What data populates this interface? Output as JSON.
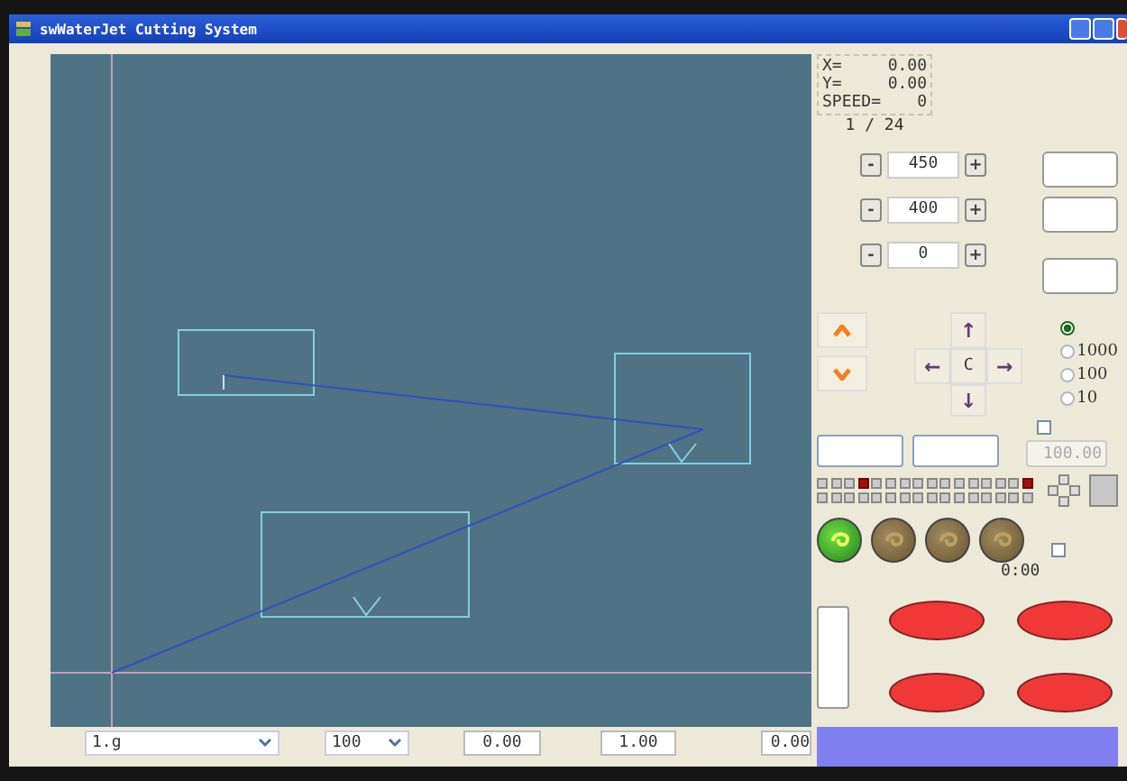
{
  "window": {
    "title": "swWaterJet Cutting System"
  },
  "readout": [
    {
      "label": "X=",
      "value": "0.00"
    },
    {
      "label": "Y=",
      "value": "0.00"
    },
    {
      "label": "SPEED=",
      "value": "0"
    }
  ],
  "page": "1 / 24",
  "steppers": [
    {
      "minus": "-",
      "value": "450",
      "plus": "+"
    },
    {
      "minus": "-",
      "value": "400",
      "plus": "+"
    },
    {
      "minus": "-",
      "value": "0",
      "plus": "+"
    }
  ],
  "jog": {
    "up": "↑",
    "left": "←",
    "center": "C",
    "right": "→",
    "down": "↓"
  },
  "radios": [
    {
      "selected": true
    },
    {
      "label": "1000",
      "selected": false
    },
    {
      "label": "100",
      "selected": false
    },
    {
      "label": "10",
      "selected": false
    }
  ],
  "checkboxes": [
    {
      "checked": false
    },
    {
      "checked": false
    }
  ],
  "fields": [
    {
      "disabled": false
    },
    {
      "disabled": false
    },
    {
      "value": "100.00",
      "disabled": true
    }
  ],
  "leds": [
    {
      "on": false
    },
    {
      "on": false
    },
    {
      "on": false
    },
    {
      "on": true
    },
    {
      "on": false
    },
    {
      "on": false
    },
    {
      "on": false
    },
    {
      "on": false
    },
    {
      "on": false
    },
    {
      "on": false
    },
    {
      "on": false
    },
    {
      "on": false
    },
    {
      "on": false
    },
    {
      "on": false
    },
    {
      "on": false
    },
    {
      "on": true
    },
    {
      "on": false
    },
    {
      "on": false
    },
    {
      "on": false
    },
    {
      "on": false
    },
    {
      "on": false
    },
    {
      "on": false
    },
    {
      "on": false
    },
    {
      "on": false
    },
    {
      "on": false
    },
    {
      "on": false
    },
    {
      "on": false
    },
    {
      "on": false
    },
    {
      "on": false
    },
    {
      "on": false
    },
    {
      "on": false
    },
    {
      "on": false
    }
  ],
  "round_buttons": [
    {
      "active": true
    },
    {
      "active": false
    },
    {
      "active": false
    },
    {
      "active": false
    }
  ],
  "timer": "0:00",
  "bottom_bar": {
    "file": "1.g",
    "speed": "100",
    "values": [
      "0.00",
      "1.00",
      "0.00"
    ]
  }
}
